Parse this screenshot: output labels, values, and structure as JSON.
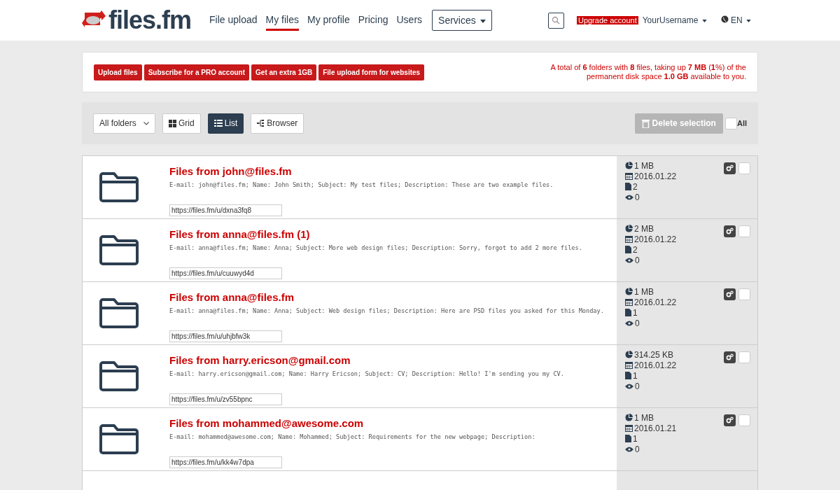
{
  "header": {
    "logo": "files.fm",
    "nav": [
      {
        "label": "File upload",
        "selected": false
      },
      {
        "label": "My files",
        "selected": true
      },
      {
        "label": "My profile",
        "selected": false
      },
      {
        "label": "Pricing",
        "selected": false
      },
      {
        "label": "Users",
        "selected": false
      }
    ],
    "services": "Services",
    "upgrade": "Upgrade account",
    "username": "YourUsername",
    "language": "EN"
  },
  "actions": [
    "Upload files",
    "Subscribe for a PRO account",
    "Get an extra 1GB",
    "File upload form for websites"
  ],
  "summary": "A total of **6** folders with **8** files, taking up **7 MB** (**1**%) of the permanent disk space **1.0 GB** available to you.",
  "toolbar": {
    "filter": "All folders",
    "views": [
      {
        "label": "Grid",
        "selected": false,
        "kind": "grid"
      },
      {
        "label": "List",
        "selected": true,
        "kind": "list"
      },
      {
        "label": "Browser",
        "selected": false,
        "kind": "browser"
      }
    ],
    "delete": "Delete selection",
    "all_label": "All",
    "all_checked": false
  },
  "folders": [
    {
      "title": "Files from john@files.fm",
      "description": "E-mail: john@files.fm; Name: John Smith; Subject: My test files; Description: These are two example files.",
      "link": "https://files.fm/u/dxna3fq8",
      "size": "1 MB",
      "date": "2016.01.22",
      "files": "2",
      "views": "0",
      "checked": false
    },
    {
      "title": "Files from anna@files.fm (1)",
      "description": "E-mail: anna@files.fm; Name: Anna; Subject: More web design files; Description: Sorry, forgot to add 2 more files.",
      "link": "https://files.fm/u/cuuwyd4d",
      "size": "2 MB",
      "date": "2016.01.22",
      "files": "2",
      "views": "0",
      "checked": false
    },
    {
      "title": "Files from anna@files.fm",
      "description": "E-mail: anna@files.fm; Name: Anna; Subject: Web design files; Description: Here are PSD files you asked for this Monday.",
      "link": "https://files.fm/u/uhjbfw3k",
      "size": "1 MB",
      "date": "2016.01.22",
      "files": "1",
      "views": "0",
      "checked": false
    },
    {
      "title": "Files from harry.ericson@gmail.com",
      "description": "E-mail: harry.ericson@gmail.com; Name: Harry Ericson; Subject: CV; Description: Hello! I'm sending you my CV.",
      "link": "https://files.fm/u/zv55bpnc",
      "size": "314.25 KB",
      "date": "2016.01.22",
      "files": "1",
      "views": "0",
      "checked": false
    },
    {
      "title": "Files from mohammed@awesome.com",
      "description": "E-mail: mohammed@awesome.com; Name: Mohammed; Subject: Requirements for the new webpage; Description:",
      "link": "https://files.fm/u/kk4w7dpa",
      "size": "1 MB",
      "date": "2016.01.21",
      "files": "1",
      "views": "0",
      "checked": false
    }
  ]
}
